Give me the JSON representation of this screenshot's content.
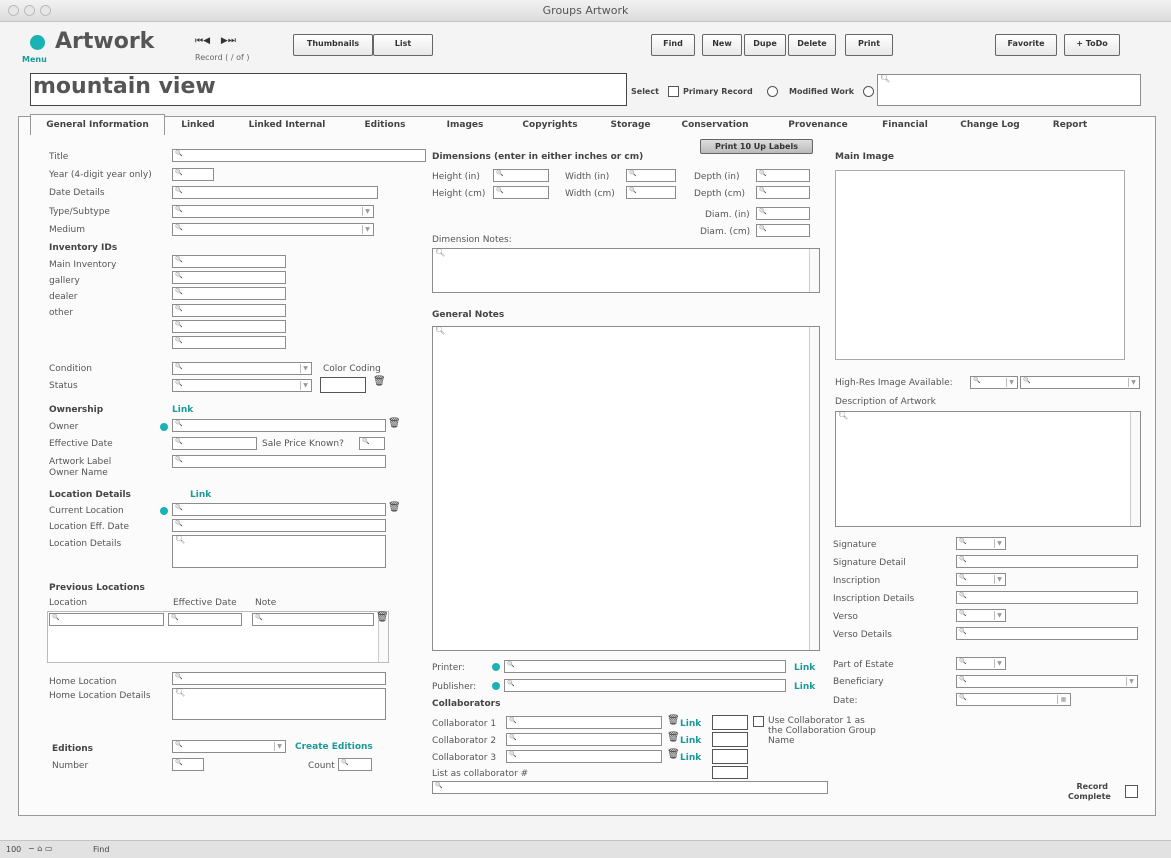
{
  "window": {
    "title": "Groups Artwork"
  },
  "header": {
    "logo_title": "Artwork",
    "menu_label": "Menu",
    "record_label": "Record ( / of )",
    "thumbnails": "Thumbnails",
    "list": "List",
    "find": "Find",
    "new": "New",
    "dupe": "Dupe",
    "delete": "Delete",
    "print": "Print",
    "favorite": "Favorite",
    "todo": "+ ToDo",
    "accent": "#19b3b3"
  },
  "record": {
    "name": "mountain view",
    "select_label": "Select",
    "primary_label": "Primary Record",
    "modified_label": "Modified Work"
  },
  "tabs": [
    "General Information",
    "Linked",
    "Linked Internal",
    "Editions",
    "Images",
    "Copyrights",
    "Storage",
    "Conservation",
    "Provenance",
    "Financial",
    "Change Log",
    "Report"
  ],
  "left": {
    "title": "Title",
    "year": "Year (4-digit year only)",
    "date_details": "Date Details",
    "type": "Type/Subtype",
    "medium": "Medium",
    "inv_header": "Inventory IDs",
    "main_inv": "Main Inventory",
    "gallery": "gallery",
    "dealer": "dealer",
    "other": "other",
    "condition": "Condition",
    "color_coding": "Color Coding",
    "status": "Status",
    "ownership": "Ownership",
    "link": "Link",
    "owner": "Owner",
    "effective_date": "Effective Date",
    "sale_price": "Sale Price Known?",
    "artwork_label": "Artwork Label Owner Name",
    "location_details_h": "Location Details",
    "current_location": "Current Location",
    "loc_eff_date": "Location Eff. Date",
    "location_details": "Location Details",
    "prev_locations": "Previous Locations",
    "col_location": "Location",
    "col_eff": "Effective Date",
    "col_note": "Note",
    "home_location": "Home Location",
    "home_location_details": "Home Location Details",
    "editions": "Editions",
    "create_editions": "Create Editions",
    "number": "Number",
    "count": "Count"
  },
  "middle": {
    "print_labels": "Print 10 Up Labels",
    "dimensions": "Dimensions (enter in either inches or cm)",
    "height_in": "Height (in)",
    "height_cm": "Height (cm)",
    "width_in": "Width (in)",
    "width_cm": "Width (cm)",
    "depth_in": "Depth (in)",
    "depth_cm": "Depth (cm)",
    "diam_in": "Diam. (in)",
    "diam_cm": "Diam. (cm)",
    "dimension_notes": "Dimension Notes:",
    "general_notes": "General Notes",
    "printer": "Printer:",
    "publisher": "Publisher:",
    "link": "Link",
    "collaborators": "Collaborators",
    "collab1": "Collaborator 1",
    "collab2": "Collaborator 2",
    "collab3": "Collaborator 3",
    "use_collab": "Use Collaborator 1 as the Collaboration Group Name",
    "list_as": "List  as collaborator #"
  },
  "right": {
    "main_image": "Main Image",
    "highres": "High-Res Image Available:",
    "description": "Description of Artwork",
    "signature": "Signature",
    "signature_detail": "Signature Detail",
    "inscription": "Inscription",
    "inscription_details": "Inscription Details",
    "verso": "Verso",
    "verso_details": "Verso Details",
    "part_of_estate": "Part of Estate",
    "beneficiary": "Beneficiary",
    "date": "Date:",
    "record_complete": "Record Complete"
  },
  "statusbar": {
    "zoom": "100",
    "mode": "Find"
  }
}
